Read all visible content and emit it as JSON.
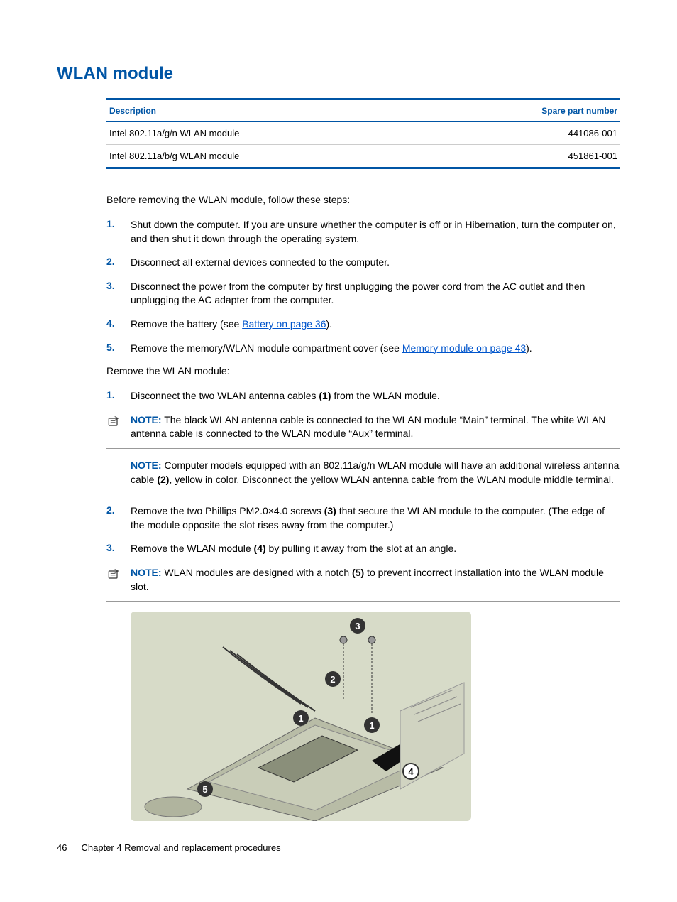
{
  "heading": "WLAN module",
  "table": {
    "headers": {
      "desc": "Description",
      "part": "Spare part number"
    },
    "rows": [
      {
        "desc": "Intel 802.11a/g/n WLAN module",
        "part": "441086-001"
      },
      {
        "desc": "Intel 802.11a/b/g WLAN module",
        "part": "451861-001"
      }
    ]
  },
  "intro": "Before removing the WLAN module, follow these steps:",
  "steps1": [
    {
      "n": "1.",
      "t": "Shut down the computer. If you are unsure whether the computer is off or in Hibernation, turn the computer on, and then shut it down through the operating system."
    },
    {
      "n": "2.",
      "t": "Disconnect all external devices connected to the computer."
    },
    {
      "n": "3.",
      "t": "Disconnect the power from the computer by first unplugging the power cord from the AC outlet and then unplugging the AC adapter from the computer."
    },
    {
      "n": "4.",
      "pre": "Remove the battery (see ",
      "link": "Battery on page 36",
      "post": ")."
    },
    {
      "n": "5.",
      "pre": "Remove the memory/WLAN module compartment cover (see ",
      "link": "Memory module on page 43",
      "post": ")."
    }
  ],
  "intro2": "Remove the WLAN module:",
  "steps2": {
    "s1": {
      "n": "1.",
      "pre": "Disconnect the two WLAN antenna cables ",
      "b": "(1)",
      "post": " from the WLAN module."
    },
    "note1": {
      "label": "NOTE:",
      "text": "The black WLAN antenna cable is connected to the WLAN module “Main” terminal. The white WLAN antenna cable is connected to the WLAN module “Aux” terminal."
    },
    "note2": {
      "label": "NOTE:",
      "pre": "Computer models equipped with an 802.11a/g/n WLAN module will have an additional wireless antenna cable ",
      "b": "(2)",
      "post": ", yellow in color. Disconnect the yellow WLAN antenna cable from the WLAN module middle terminal."
    },
    "s2": {
      "n": "2.",
      "pre": "Remove the two Phillips PM2.0×4.0 screws ",
      "b": "(3)",
      "post": " that secure the WLAN module to the computer. (The edge of the module opposite the slot rises away from the computer.)"
    },
    "s3": {
      "n": "3.",
      "pre": "Remove the WLAN module ",
      "b": "(4)",
      "post": " by pulling it away from the slot at an angle."
    },
    "note3": {
      "label": "NOTE:",
      "pre": "WLAN modules are designed with a notch ",
      "b": "(5)",
      "post": " to prevent incorrect installation into the WLAN module slot."
    }
  },
  "footer": {
    "page": "46",
    "chapter": "Chapter 4   Removal and replacement procedures"
  },
  "callouts": {
    "c1": "1",
    "c2": "2",
    "c3": "3",
    "c4": "4",
    "c5": "5"
  }
}
